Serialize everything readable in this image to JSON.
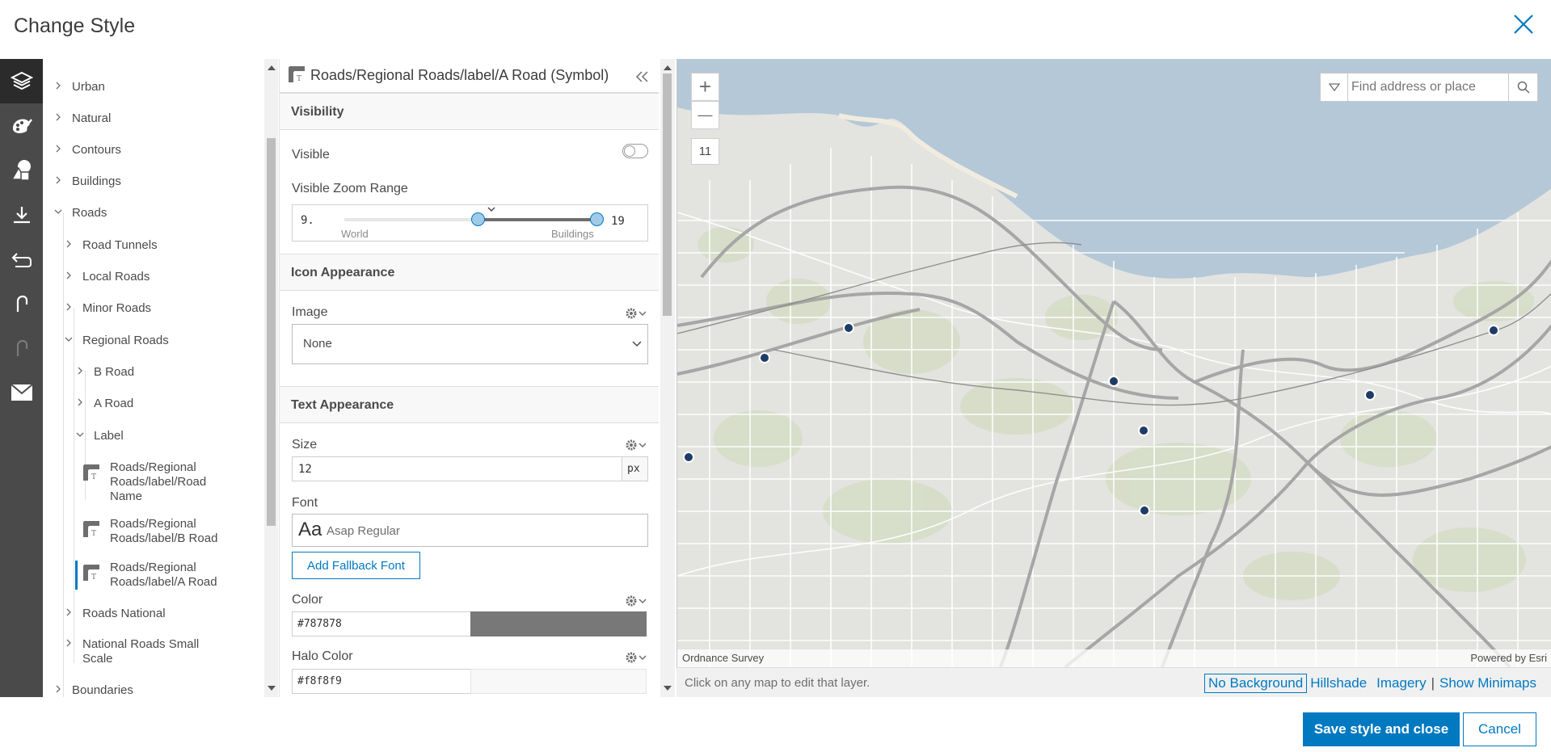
{
  "dialog": {
    "title": "Change Style"
  },
  "toolbar": {
    "items": [
      {
        "icon": "layers-icon"
      },
      {
        "icon": "paint-palette-icon"
      },
      {
        "icon": "shapes-icon"
      },
      {
        "icon": "download-icon"
      },
      {
        "icon": "undo-icon"
      },
      {
        "icon": "undo-arrow-icon"
      },
      {
        "icon": "redo-arrow-icon"
      },
      {
        "icon": "envelope-icon"
      }
    ]
  },
  "tree": {
    "items": [
      {
        "label": "Urban",
        "expanded": false
      },
      {
        "label": "Natural",
        "expanded": false
      },
      {
        "label": "Contours",
        "expanded": false
      },
      {
        "label": "Buildings",
        "expanded": false
      },
      {
        "label": "Roads",
        "expanded": true
      },
      {
        "label": "Road Tunnels",
        "expanded": false
      },
      {
        "label": "Local Roads",
        "expanded": false
      },
      {
        "label": "Minor Roads",
        "expanded": false
      },
      {
        "label": "Regional Roads",
        "expanded": true
      },
      {
        "label": "B Road",
        "expanded": false
      },
      {
        "label": "A Road",
        "expanded": false
      },
      {
        "label": "Label",
        "expanded": true
      },
      {
        "label": "Roads National",
        "expanded": false
      },
      {
        "label": "National Roads Small Scale",
        "expanded": false
      },
      {
        "label": "Boundaries",
        "expanded": false
      }
    ],
    "leaves": [
      {
        "label": "Roads/Regional Roads/label/Road Name"
      },
      {
        "label": "Roads/Regional Roads/label/B Road"
      },
      {
        "label": "Roads/Regional Roads/label/A Road",
        "selected": true
      }
    ]
  },
  "panel": {
    "title": "Roads/Regional Roads/label/A Road (Symbol)",
    "visibility": {
      "header": "Visibility",
      "visible_label": "Visible",
      "visible": false,
      "zoom_range_label": "Visible Zoom Range",
      "min_value": "9.",
      "max_value": "19",
      "world_label": "World",
      "buildings_label": "Buildings"
    },
    "icon": {
      "header": "Icon Appearance",
      "image_label": "Image",
      "image_value": "None"
    },
    "text": {
      "header": "Text Appearance",
      "size_label": "Size",
      "size_value": "12",
      "size_unit": "px",
      "font_label": "Font",
      "font_sample": "Aa",
      "font_value": "Asap Regular",
      "fallback_button": "Add Fallback Font",
      "color_label": "Color",
      "color_value": "#787878",
      "halo_label": "Halo Color",
      "halo_value": "#f8f8f9"
    }
  },
  "map": {
    "zoom_in": "+",
    "zoom_out": "—",
    "zoom_level": "11",
    "search_placeholder": "Find address or place",
    "attribution_left": "Ordnance Survey",
    "attribution_right": "Powered by Esri",
    "hint": "Click on any map to edit that layer.",
    "basemaps": [
      {
        "label": "No Background",
        "active": true
      },
      {
        "label": "Hillshade",
        "active": false
      },
      {
        "label": "Imagery",
        "active": false
      }
    ],
    "minimaps_label": "Show Minimaps"
  },
  "footer": {
    "save_label": "Save style and close",
    "cancel_label": "Cancel"
  },
  "colors": {
    "accent": "#0079c1",
    "toolbar_bg": "#4a4a4a",
    "water": "#b4c8d7",
    "text_color_swatch": "#787878",
    "halo_swatch": "#f8f8f9"
  }
}
